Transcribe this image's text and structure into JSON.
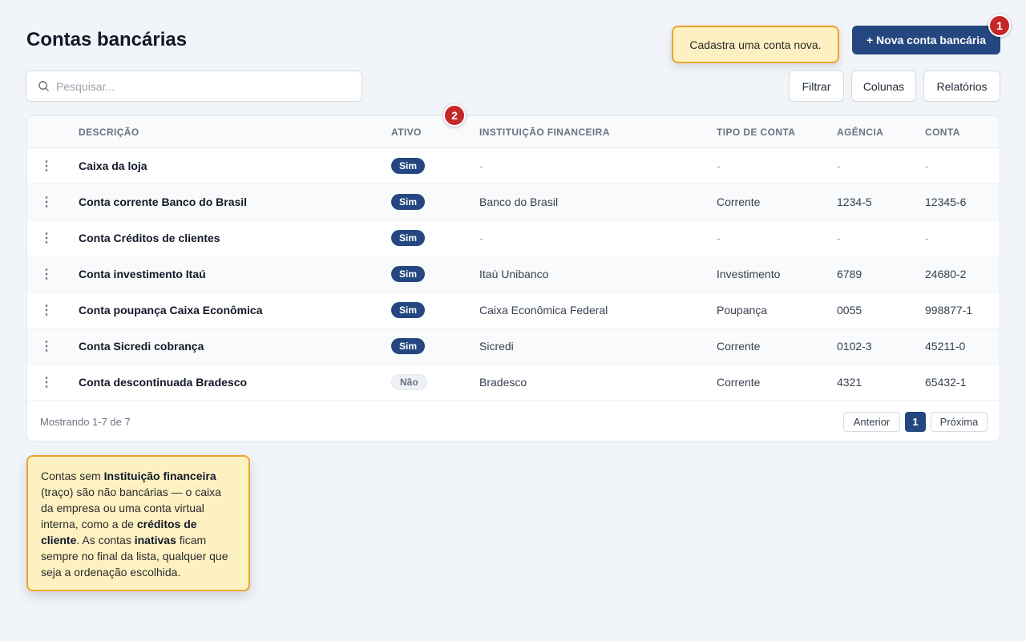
{
  "header": {
    "title": "Contas bancárias",
    "new_button": "+ Nova conta bancária",
    "new_tooltip": "Cadastra uma conta nova."
  },
  "steps": {
    "one": "1",
    "two": "2"
  },
  "search": {
    "placeholder": "Pesquisar...",
    "value": ""
  },
  "toolbar": {
    "filter": "Filtrar",
    "columns": "Colunas",
    "reports": "Relatórios"
  },
  "table": {
    "columns": {
      "description": "DESCRIÇÃO",
      "active": "ATIVO",
      "institution": "INSTITUIÇÃO FINANCEIRA",
      "type": "TIPO DE CONTA",
      "agency": "AGÊNCIA",
      "account": "CONTA"
    },
    "rows": [
      {
        "description": "Caixa da loja",
        "active": "Sim",
        "institution": "-",
        "type": "-",
        "agency": "-",
        "account": "-"
      },
      {
        "description": "Conta corrente Banco do Brasil",
        "active": "Sim",
        "institution": "Banco do Brasil",
        "type": "Corrente",
        "agency": "1234-5",
        "account": "12345-6"
      },
      {
        "description": "Conta Créditos de clientes",
        "active": "Sim",
        "institution": "-",
        "type": "-",
        "agency": "-",
        "account": "-"
      },
      {
        "description": "Conta investimento Itaú",
        "active": "Sim",
        "institution": "Itaú Unibanco",
        "type": "Investimento",
        "agency": "6789",
        "account": "24680-2"
      },
      {
        "description": "Conta poupança Caixa Econômica",
        "active": "Sim",
        "institution": "Caixa Econômica Federal",
        "type": "Poupança",
        "agency": "0055",
        "account": "998877-1"
      },
      {
        "description": "Conta Sicredi cobrança",
        "active": "Sim",
        "institution": "Sicredi",
        "type": "Corrente",
        "agency": "0102-3",
        "account": "45211-0"
      },
      {
        "description": "Conta descontinuada Bradesco",
        "active": "Não",
        "institution": "Bradesco",
        "type": "Corrente",
        "agency": "4321",
        "account": "65432-1"
      }
    ],
    "kebab": "⋮"
  },
  "pagination": {
    "summary": "Mostrando 1-7 de 7",
    "prev": "Anterior",
    "page": "1",
    "next": "Próxima"
  },
  "note": {
    "t1": "Contas sem ",
    "b1": "Instituição financeira",
    "t2": " (traço) são não bancárias — o caixa da empresa ou uma conta virtual interna, como a de ",
    "b2": "créditos de cliente",
    "t3": ". As contas ",
    "b3": "inativas",
    "t4": " ficam sempre no final da lista, qualquer que seja a ordenação escolhida."
  },
  "colors": {
    "primary": "#24477f",
    "step_badge": "#c62828",
    "tooltip_bg": "#fdf1c2",
    "tooltip_border": "#eba52e"
  }
}
